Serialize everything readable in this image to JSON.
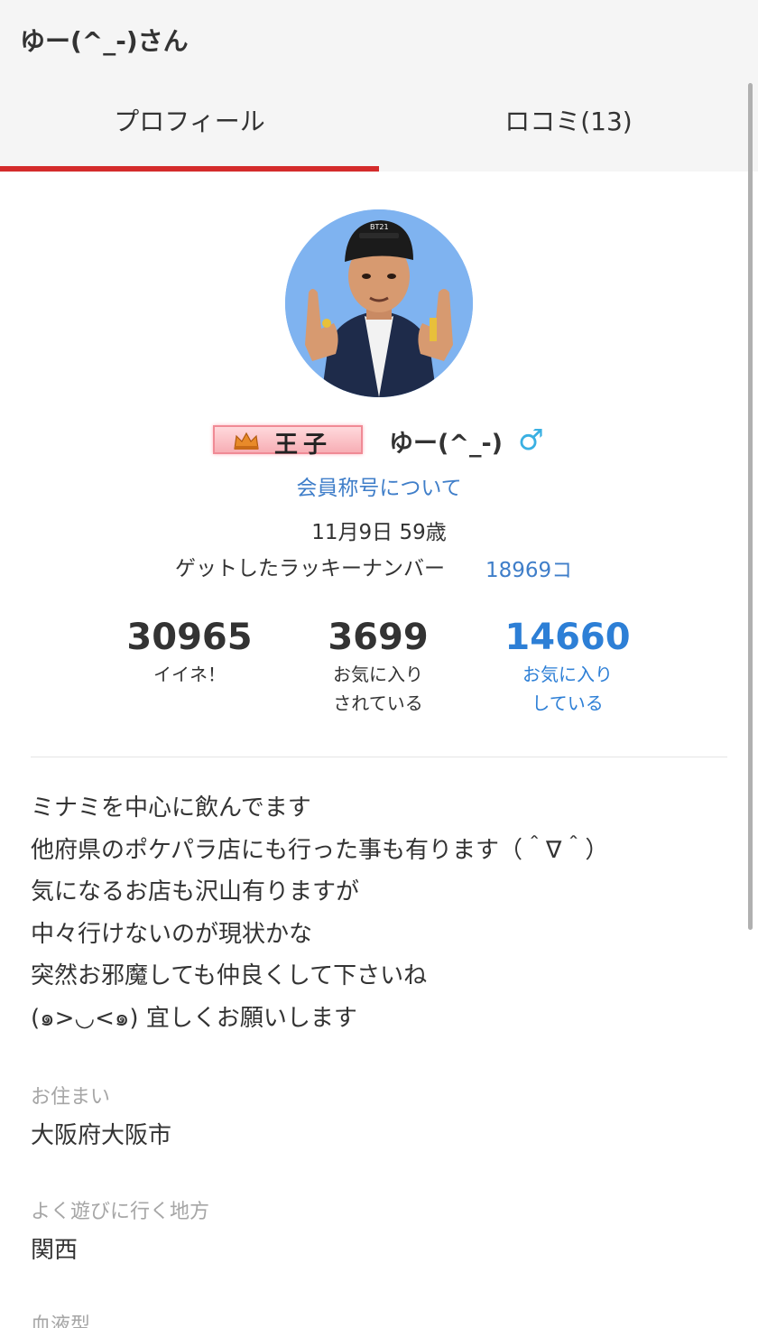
{
  "header": {
    "title": "ゆー(^_-)さん"
  },
  "tabs": [
    {
      "label": "プロフィール",
      "active": true
    },
    {
      "label": "ロコミ(13)",
      "active": false
    }
  ],
  "colors": {
    "accent": "#d42b2b",
    "link": "#3f7ec9",
    "highlight": "#2d7fd6",
    "gender": "#3ab0e2"
  },
  "profile": {
    "avatar": "avatar-3d-character-image",
    "title_badge": "王子",
    "username": "ゆー(^_-)",
    "gender_icon": "♂",
    "rank_link": "会員称号について",
    "birthday": "11月9日 59歳",
    "lucky_label": "ゲットしたラッキーナンバー",
    "lucky_value": "18969コ"
  },
  "stats": {
    "likes": {
      "value": "30965",
      "label": "イイネ！"
    },
    "faved": {
      "value": "3699",
      "label1": "お気に入り",
      "label2": "されている"
    },
    "faving": {
      "value": "14660",
      "label1": "お気に入り",
      "label2": "している"
    }
  },
  "bio": [
    "ミナミを中心に飲んでます",
    "他府県のポケパラ店にも行った事も有ります（＾∇＾）",
    "気になるお店も沢山有りますが",
    "中々行けないのが現状かな",
    "突然お邪魔しても仲良くして下さいね",
    "(๑>◡<๑) 宜しくお願いします"
  ],
  "fields": {
    "residence_label": "お住まい",
    "residence_value": "大阪府大阪市",
    "area_label": "よく遊びに行く地方",
    "area_value": "関西",
    "blood_label": "血液型"
  }
}
